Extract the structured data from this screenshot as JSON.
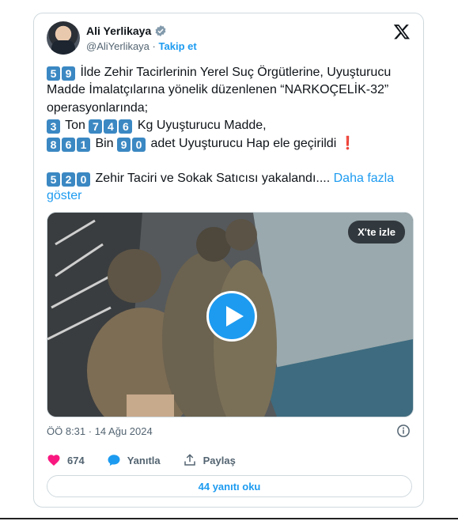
{
  "author": {
    "name": "Ali Yerlikaya",
    "handle": "@AliYerlikaya",
    "separator": "·",
    "follow_label": "Takip et"
  },
  "tweet": {
    "line1_nums": [
      "5",
      "9"
    ],
    "line1_text": " İlde Zehir Tacirlerinin Yerel Suç Örgütlerine, Uyuşturucu Madde İmalatçılarına yönelik düzenlenen “NARKOÇELİK-32”  operasyonlarında;",
    "line2_num_a": "3",
    "line2_text_a": " Ton ",
    "line2_nums_b": [
      "7",
      "4",
      "6"
    ],
    "line2_text_b": " Kg Uyuşturucu Madde,",
    "line3_nums_a": [
      "8",
      "6",
      "1"
    ],
    "line3_text_a": " Bin ",
    "line3_nums_b": [
      "9",
      "0"
    ],
    "line3_text_b": " adet Uyuşturucu Hap ele geçirildi",
    "line3_excl": "❗",
    "line4_nums": [
      "5",
      "2",
      "0"
    ],
    "line4_text": " Zehir Taciri ve Sokak Satıcısı yakalandı....",
    "show_more": "Daha fazla göster"
  },
  "media": {
    "watch_label": "X'te izle",
    "icons": {
      "play": "play-icon"
    }
  },
  "timestamp": "ÖÖ 8:31 · 14 Ağu 2024",
  "actions": {
    "likes": "674",
    "reply_label": "Yanıtla",
    "share_label": "Paylaş"
  },
  "replies_button": "44 yanıtı oku",
  "colors": {
    "accent": "#1d9bf0",
    "like": "#f91880",
    "keycap": "#3b88c3",
    "text": "#0f1419",
    "muted": "#536471"
  }
}
